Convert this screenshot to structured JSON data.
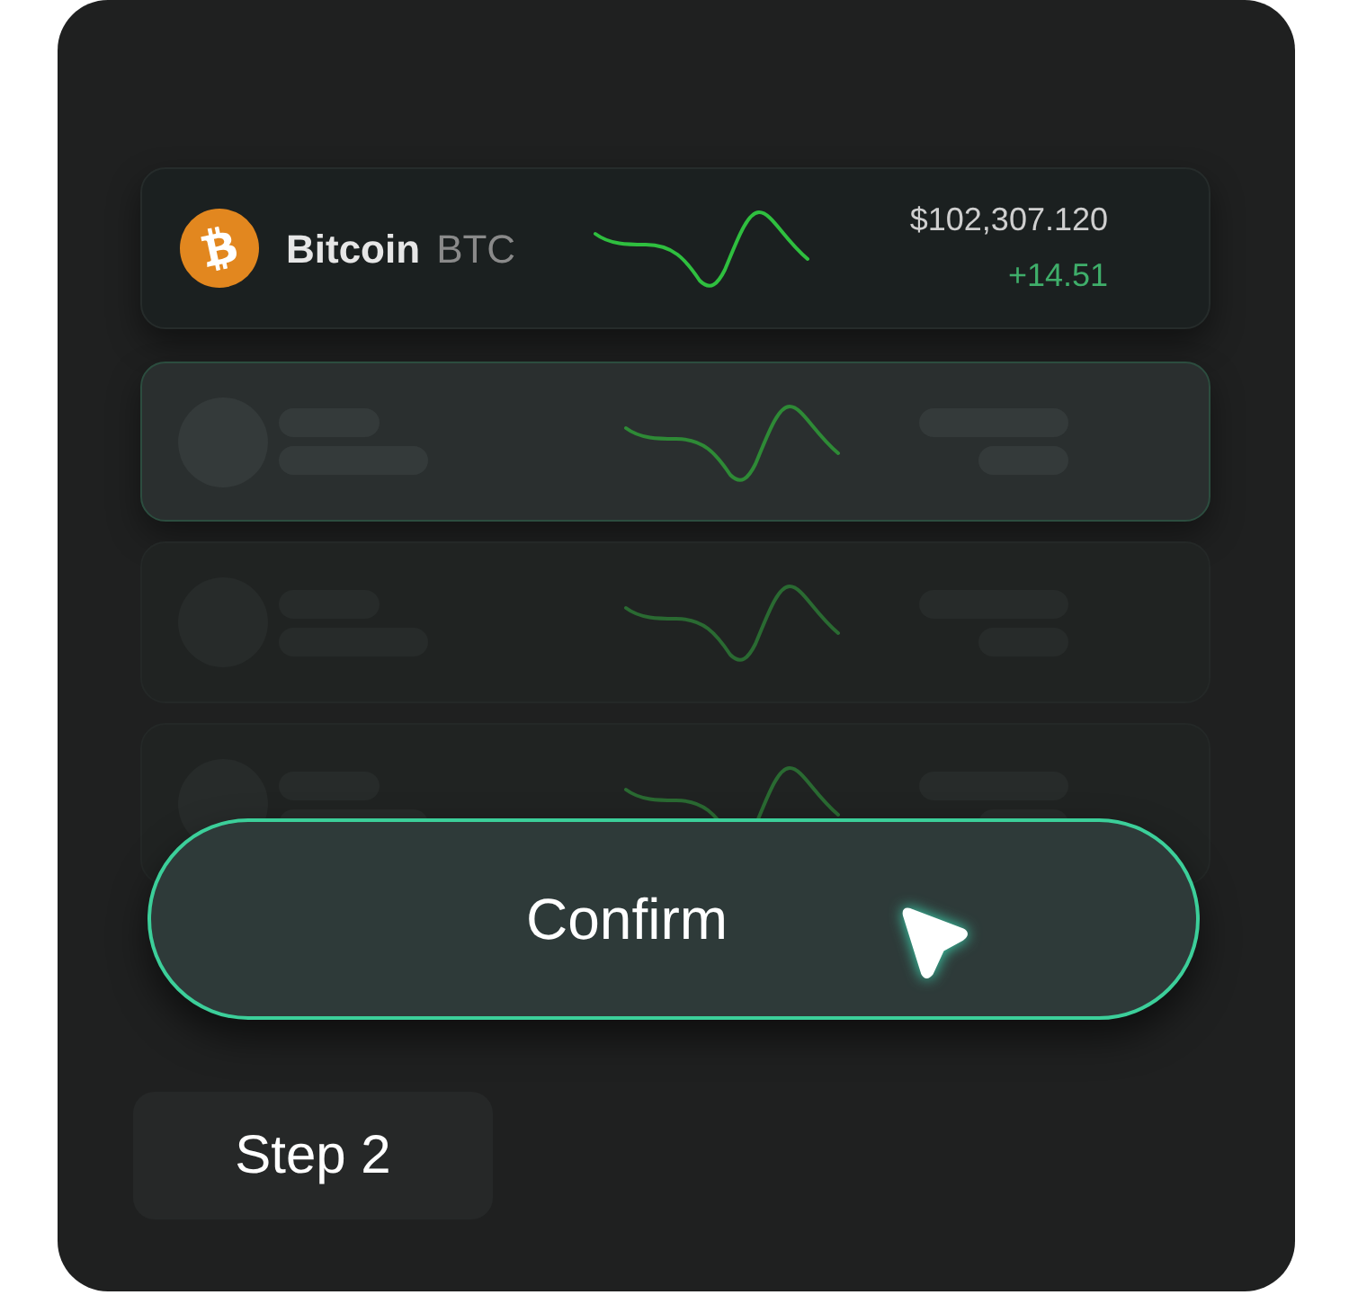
{
  "cards": [
    {
      "kind": "coin",
      "name": "Bitcoin",
      "symbol": "BTC",
      "price": "$102,307.120",
      "change": "+14.51"
    },
    {
      "kind": "skeleton",
      "highlighted": true
    },
    {
      "kind": "skeleton",
      "highlighted": false
    },
    {
      "kind": "skeleton",
      "highlighted": false
    }
  ],
  "confirm_button": {
    "label": "Confirm"
  },
  "step": {
    "label": "Step 2"
  }
}
